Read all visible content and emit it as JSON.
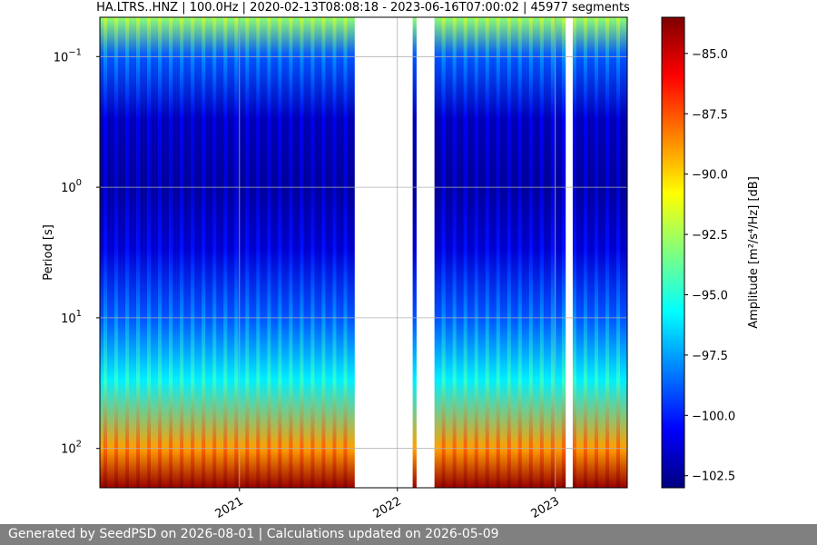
{
  "chart_data": {
    "type": "heatmap",
    "title": "HA.LTRS..HNZ | 100.0Hz | 2020-02-13T08:08:18 - 2023-06-16T07:00:02 | 45977 segments",
    "xlabel": "",
    "ylabel": "Period [s]",
    "x_tick_labels": [
      "2021",
      "2022",
      "2023"
    ],
    "y_scale": "log",
    "y_inverted": true,
    "y_tick_labels": [
      {
        "base": "10",
        "exp": "−1",
        "value": 0.1
      },
      {
        "base": "10",
        "exp": "0",
        "value": 1
      },
      {
        "base": "10",
        "exp": "1",
        "value": 10
      },
      {
        "base": "10",
        "exp": "2",
        "value": 100
      }
    ],
    "ylim": [
      0.05,
      200
    ],
    "grid": true,
    "colormap": "jet",
    "colorbar": {
      "label": "Amplitude [m²/s⁴/Hz] [dB]",
      "range": [
        -103,
        -83.5
      ],
      "tick_labels": [
        "−85.0",
        "−87.5",
        "−90.0",
        "−92.5",
        "−95.0",
        "−97.5",
        "−100.0",
        "−102.5"
      ],
      "ticks": [
        -85.0,
        -87.5,
        -90.0,
        -92.5,
        -95.0,
        -97.5,
        -100.0,
        -102.5
      ]
    },
    "data_gaps": [
      {
        "start": "2021-09-21",
        "end": "2022-02-06"
      },
      {
        "start": "2022-02-10",
        "end": "2022-03-27"
      },
      {
        "start": "2023-01-22",
        "end": "2023-02-10"
      }
    ],
    "amplitude_profile_db": [
      {
        "period_s": 0.05,
        "amplitude": -93
      },
      {
        "period_s": 0.1,
        "amplitude": -99
      },
      {
        "period_s": 0.3,
        "amplitude": -102
      },
      {
        "period_s": 1,
        "amplitude": -102.5
      },
      {
        "period_s": 3,
        "amplitude": -101.5
      },
      {
        "period_s": 10,
        "amplitude": -99
      },
      {
        "period_s": 30,
        "amplitude": -96
      },
      {
        "period_s": 100,
        "amplitude": -89
      },
      {
        "period_s": 200,
        "amplitude": -84
      }
    ]
  },
  "footer": {
    "text": "Generated by SeedPSD on 2026-08-01 | Calculations updated on 2026-05-09"
  }
}
